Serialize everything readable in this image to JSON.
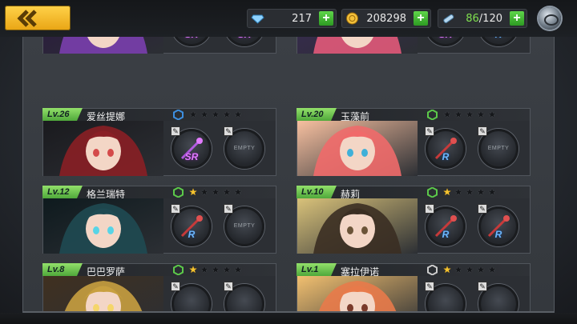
{
  "resources": {
    "diamonds": "217",
    "coins": "208298",
    "stamina_current": "86",
    "stamina_max": "/120"
  },
  "slot_labels": {
    "empty": "EMPTY"
  },
  "cards": [
    {
      "level": "",
      "name": "",
      "stars_filled": 0,
      "weapon_grade": "SR",
      "skill_grade": "SR",
      "skill_locked": false
    },
    {
      "level": "",
      "name": "",
      "stars_filled": 0,
      "weapon_grade": "SR",
      "skill_grade": "R",
      "skill_locked": true
    },
    {
      "level": "Lv.26",
      "name": "爱丝提娜",
      "hex_color": "#3d8fe0",
      "stars_filled": 0,
      "weapon_grade": "SR",
      "skill_grade": "EMPTY"
    },
    {
      "level": "Lv.20",
      "name": "玉藻前",
      "hex_color": "#5cc94a",
      "stars_filled": 0,
      "weapon_grade": "R",
      "skill_grade": "EMPTY"
    },
    {
      "level": "Lv.12",
      "name": "格兰瑞特",
      "hex_color": "#5cc94a",
      "stars_filled": 1,
      "weapon_grade": "R",
      "skill_grade": "EMPTY"
    },
    {
      "level": "Lv.10",
      "name": "赫莉",
      "hex_color": "#5cc94a",
      "stars_filled": 1,
      "weapon_grade": "R",
      "skill_grade": "R"
    },
    {
      "level": "Lv.8",
      "name": "巴巴罗萨",
      "hex_color": "#5cc94a",
      "stars_filled": 1,
      "weapon_grade": "",
      "skill_grade": ""
    },
    {
      "level": "Lv.1",
      "name": "塞拉伊诺",
      "hex_color": "#cccccc",
      "stars_filled": 1,
      "weapon_grade": "",
      "skill_grade": ""
    }
  ],
  "colors": {
    "accent": "#f2b92a",
    "level_badge": "#6fc94f",
    "plus": "#3fb82f",
    "sr": "#e27bff",
    "r": "#6db8ff"
  },
  "icons": [
    "back-arrow-icon",
    "diamond-icon",
    "coin-icon",
    "stamina-icon",
    "plus-icon",
    "settings-icon",
    "edit-icon",
    "star-icon",
    "hexagon-icon",
    "lock-icon"
  ]
}
